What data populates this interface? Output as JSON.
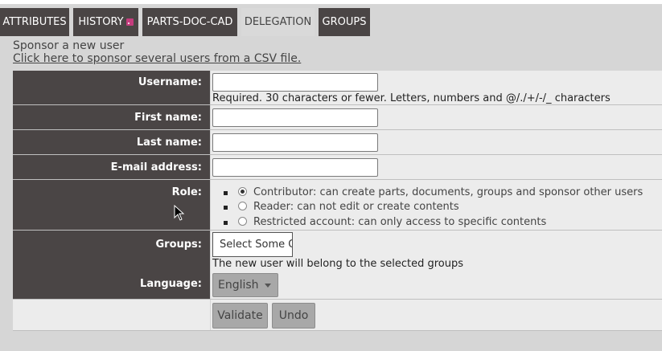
{
  "tabs": [
    {
      "label": "ATTRIBUTES"
    },
    {
      "label": "HISTORY",
      "icon": "rss-feed-icon"
    },
    {
      "label": "PARTS-DOC-CAD"
    },
    {
      "label": "DELEGATION",
      "active": true
    },
    {
      "label": "GROUPS"
    }
  ],
  "intro": {
    "title": "Sponsor a new user",
    "csv_link": "Click here to sponsor several users from a CSV file."
  },
  "form": {
    "username_label": "Username:",
    "username_help": "Required. 30 characters or fewer. Letters, numbers and @/./+/-/_ characters",
    "first_name_label": "First name:",
    "last_name_label": "Last name:",
    "email_label": "E-mail address:",
    "role_label": "Role:",
    "roles": [
      {
        "label": "Contributor: can create parts, documents, groups and sponsor other users",
        "selected": true
      },
      {
        "label": "Reader: can not edit or create contents",
        "selected": false
      },
      {
        "label": "Restricted account: can only access to specific contents",
        "selected": false
      }
    ],
    "groups_label": "Groups:",
    "groups_placeholder": "Select Some Options",
    "groups_help": "The new user will belong to the selected groups",
    "language_label": "Language:",
    "language_value": "English",
    "validate_label": "Validate",
    "undo_label": "Undo"
  },
  "colors": {
    "tab_bg": "#4a4545",
    "active_tab_bg": "#d9d9d9",
    "label_bg": "#4a4545",
    "panel_bg": "#d6d6d6",
    "rss_icon": "#c43c7d"
  }
}
